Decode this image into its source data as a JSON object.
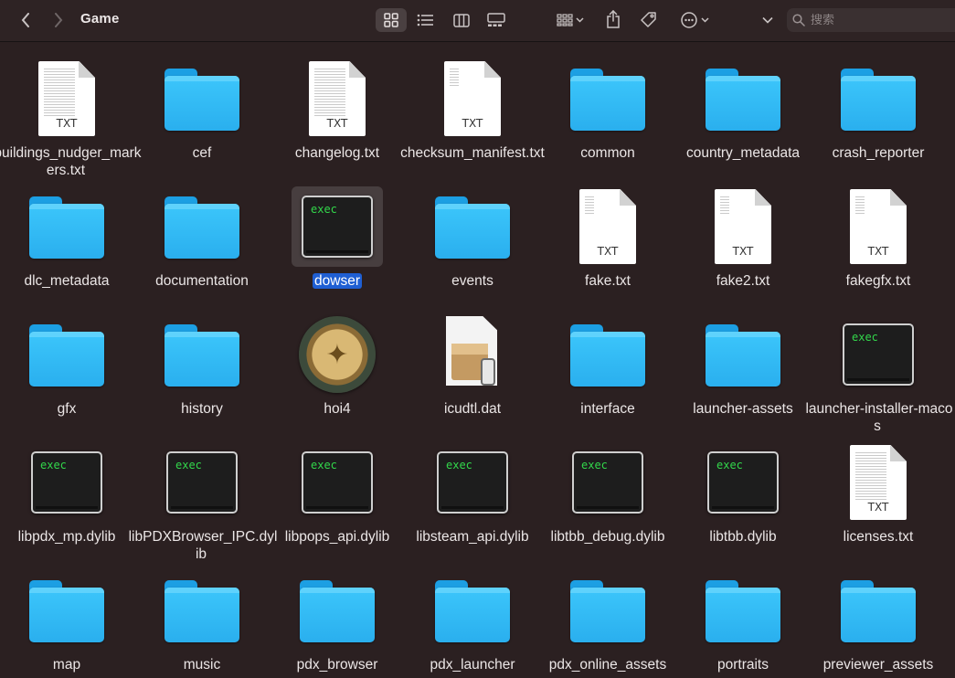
{
  "window": {
    "title": "Game"
  },
  "search": {
    "placeholder": "搜索"
  },
  "files": [
    {
      "name": "buildings_nudger_markers.txt",
      "kind": "txt",
      "text_style": "dense"
    },
    {
      "name": "cef",
      "kind": "folder"
    },
    {
      "name": "changelog.txt",
      "kind": "txt",
      "text_style": "dense"
    },
    {
      "name": "checksum_manifest.txt",
      "kind": "txt",
      "text_style": "sparse"
    },
    {
      "name": "common",
      "kind": "folder"
    },
    {
      "name": "country_metadata",
      "kind": "folder"
    },
    {
      "name": "crash_reporter",
      "kind": "folder"
    },
    {
      "name": "dlc_metadata",
      "kind": "folder"
    },
    {
      "name": "documentation",
      "kind": "folder"
    },
    {
      "name": "dowser",
      "kind": "exec",
      "selected": true
    },
    {
      "name": "events",
      "kind": "folder"
    },
    {
      "name": "fake.txt",
      "kind": "txt",
      "text_style": "sparse"
    },
    {
      "name": "fake2.txt",
      "kind": "txt",
      "text_style": "sparse"
    },
    {
      "name": "fakegfx.txt",
      "kind": "txt",
      "text_style": "sparse"
    },
    {
      "name": "gfx",
      "kind": "folder"
    },
    {
      "name": "history",
      "kind": "folder"
    },
    {
      "name": "hoi4",
      "kind": "app"
    },
    {
      "name": "icudtl.dat",
      "kind": "installer"
    },
    {
      "name": "interface",
      "kind": "folder"
    },
    {
      "name": "launcher-assets",
      "kind": "folder"
    },
    {
      "name": "launcher-installer-macos",
      "kind": "exec"
    },
    {
      "name": "libpdx_mp.dylib",
      "kind": "exec"
    },
    {
      "name": "libPDXBrowser_IPC.dylib",
      "kind": "exec"
    },
    {
      "name": "libpops_api.dylib",
      "kind": "exec"
    },
    {
      "name": "libsteam_api.dylib",
      "kind": "exec"
    },
    {
      "name": "libtbb_debug.dylib",
      "kind": "exec"
    },
    {
      "name": "libtbb.dylib",
      "kind": "exec"
    },
    {
      "name": "licenses.txt",
      "kind": "txt",
      "text_style": "dense"
    },
    {
      "name": "map",
      "kind": "folder"
    },
    {
      "name": "music",
      "kind": "folder"
    },
    {
      "name": "pdx_browser",
      "kind": "folder"
    },
    {
      "name": "pdx_launcher",
      "kind": "folder"
    },
    {
      "name": "pdx_online_assets",
      "kind": "folder"
    },
    {
      "name": "portraits",
      "kind": "folder"
    },
    {
      "name": "previewer_assets",
      "kind": "folder"
    }
  ],
  "labels": {
    "txt_ext": "TXT",
    "exec_text": "exec"
  },
  "colors": {
    "selection": "#1f5fd3",
    "folder": "#35bdf8",
    "background": "#2b2021",
    "exec_green": "#32d74b"
  }
}
